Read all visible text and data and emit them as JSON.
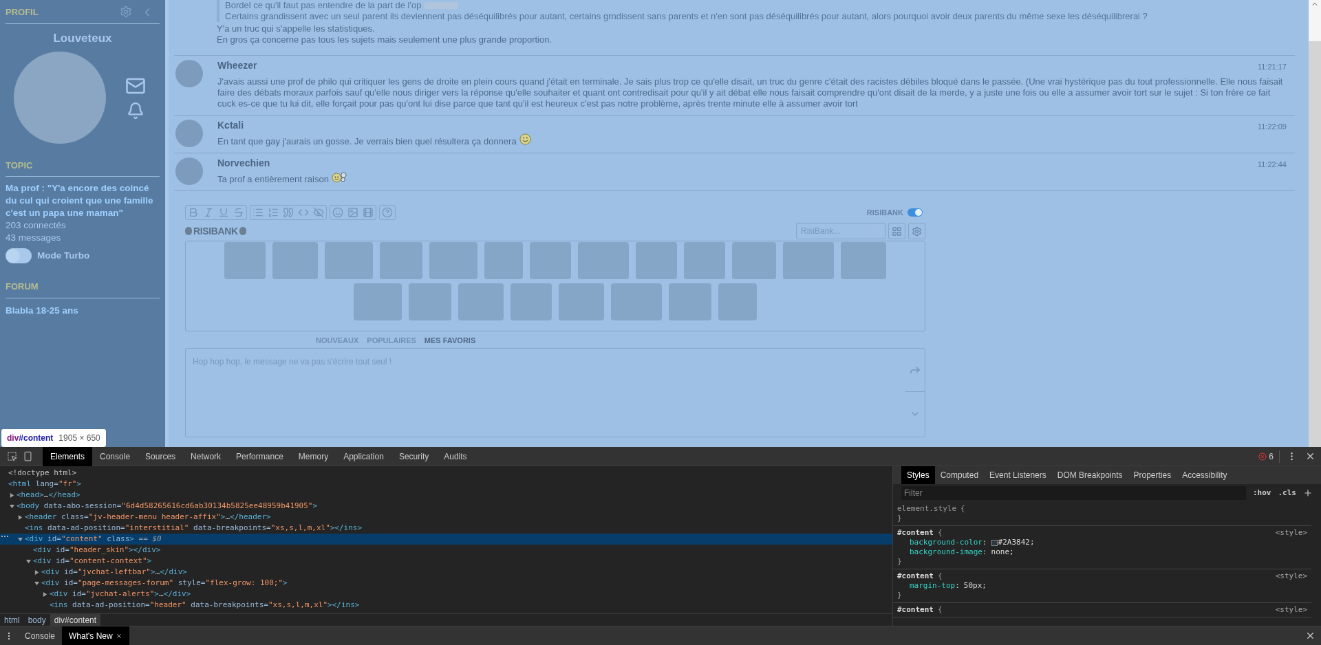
{
  "sidebar": {
    "profile": {
      "heading": "PROFIL",
      "username": "Louveteux"
    },
    "topic": {
      "heading": "TOPIC",
      "title": "Ma prof : \"Y'a encore des coincé du cul qui croient que une famille c'est un papa une maman\"",
      "connected": "203 connectés",
      "messages": "43 messages",
      "turbo": {
        "label": "Mode Turbo",
        "on": false
      }
    },
    "forum": {
      "heading": "FORUM",
      "name": "Blabla 18-25 ans"
    }
  },
  "thread": {
    "continuation": {
      "quote": [
        "Bordel ce qu'il faut pas entendre de la part de l'op",
        "Certains grandissent avec un seul parent ils deviennent pas déséquilibrés pour autant, certains grndissent sans parents et n'en sont pas déséquilibrés pour autant, alors pourquoi avoir deux parents du même sexe les déséquilibrerai ?"
      ],
      "lines": [
        "Y'a un truc qui s'appelle les statistiques.",
        "En gros ça concerne pas tous les sujets mais seulement une plus grande proportion."
      ]
    },
    "messages": [
      {
        "author": "Wheezer",
        "time": "11:21:17",
        "text": "J'avais aussi une prof de philo qui critiquer les gens de droite en plein cours quand j'était en terminale. Je sais plus trop ce qu'elle disait, un truc du genre c'était des racistes débiles bloqué dans le passée. (Une vrai hystérique pas du tout professionnelle. Elle nous faisait faire des débats moraux parfois sauf qu'elle nous diriger vers la réponse qu'elle souhaiter et quant ont contredisait pour qu'il y ait débat elle nous faisait comprendre qu'ont disait de la merde, y a juste une fois ou elle a assumer avoir tort sur le sujet : Si ton frère ce fait cuck es-ce que tu lui dit, elle forçait pour pas qu'ont lui dise parce que tant qu'il est heureux c'est pas notre problème, après trente minute elle à assumer avoir tort"
      },
      {
        "author": "Kctali",
        "time": "11:22:09",
        "text": "En tant que gay j'aurais un gosse. Je verrais bien quel résultera ça donnera",
        "emoticon": {
          "kind": "smile"
        }
      },
      {
        "author": "Norvechien",
        "time": "11:22:44",
        "text": "Ta prof a entièrement raison",
        "emoticon": {
          "kind": "bubble"
        }
      }
    ]
  },
  "editor": {
    "risibank_toggle": {
      "label": "RISIBANK",
      "on": true
    },
    "logo": "RISIBANK",
    "search": {
      "placeholder": "RisiBank..."
    },
    "tabs": [
      {
        "label": "NOUVEAUX",
        "selected": false
      },
      {
        "label": "POPULAIRES",
        "selected": false
      },
      {
        "label": "MES FAVORIS",
        "selected": true
      }
    ],
    "message": {
      "placeholder": "Hop hop hop, le message ne va pas s'écrire tout seul !"
    }
  },
  "inspect_tooltip": {
    "tag": "div",
    "id": "#content",
    "size": "1905 × 650"
  },
  "devtools": {
    "tabs": [
      {
        "label": "Elements",
        "selected": true
      },
      {
        "label": "Console",
        "selected": false
      },
      {
        "label": "Sources",
        "selected": false
      },
      {
        "label": "Network",
        "selected": false
      },
      {
        "label": "Performance",
        "selected": false
      },
      {
        "label": "Memory",
        "selected": false
      },
      {
        "label": "Application",
        "selected": false
      },
      {
        "label": "Security",
        "selected": false
      },
      {
        "label": "Audits",
        "selected": false
      }
    ],
    "error_count": "6",
    "dom": [
      {
        "tokens": [
          {
            "kind": "doctype",
            "t": "<!doctype html>"
          }
        ],
        "selected": false
      },
      {
        "tokens": [
          {
            "kind": "tag",
            "t": "<html"
          },
          {
            "kind": "attr",
            "t": " lang="
          },
          {
            "kind": "value",
            "t": "\"fr\""
          },
          {
            "kind": "tag",
            "t": ">"
          }
        ],
        "selected": false,
        "children": [
          {
            "tokens": [
              {
                "kind": "tag",
                "t": "<head>"
              },
              {
                "kind": "text",
                "t": "…"
              },
              {
                "kind": "tag",
                "t": "</head>"
              }
            ],
            "expanded": false,
            "selected": false
          },
          {
            "tokens": [
              {
                "kind": "tag",
                "t": "<body"
              },
              {
                "kind": "attr",
                "t": " data-abo-session="
              },
              {
                "kind": "value",
                "t": "\"6d4d58265616cd6ab30134b5825ee48959b41905\""
              },
              {
                "kind": "tag",
                "t": ">"
              }
            ],
            "expanded": true,
            "selected": false,
            "children": [
              {
                "tokens": [
                  {
                    "kind": "tag",
                    "t": "<header"
                  },
                  {
                    "kind": "attr",
                    "t": " class="
                  },
                  {
                    "kind": "value",
                    "t": "\"jv-header-menu header-affix\""
                  },
                  {
                    "kind": "tag",
                    "t": ">"
                  },
                  {
                    "kind": "text",
                    "t": "…"
                  },
                  {
                    "kind": "tag",
                    "t": "</header>"
                  }
                ],
                "expanded": false,
                "selected": false
              },
              {
                "tokens": [
                  {
                    "kind": "tag",
                    "t": "<ins"
                  },
                  {
                    "kind": "attr",
                    "t": " data-ad-position="
                  },
                  {
                    "kind": "value",
                    "t": "\"interstitial\""
                  },
                  {
                    "kind": "attr",
                    "t": " data-breakpoints="
                  },
                  {
                    "kind": "value",
                    "t": "\"xs,s,l,m,xl\""
                  },
                  {
                    "kind": "tag",
                    "t": "></ins>"
                  }
                ],
                "selected": false
              },
              {
                "tokens": [
                  {
                    "kind": "tag",
                    "t": "<div"
                  },
                  {
                    "kind": "attr",
                    "t": " id="
                  },
                  {
                    "kind": "value",
                    "t": "\"content\""
                  },
                  {
                    "kind": "attr",
                    "t": " class"
                  },
                  {
                    "kind": "tag",
                    "t": ">"
                  },
                  {
                    "kind": "hint",
                    "t": " == $0"
                  }
                ],
                "expanded": true,
                "selected": true,
                "children": [
                  {
                    "tokens": [
                      {
                        "kind": "tag",
                        "t": "<div"
                      },
                      {
                        "kind": "attr",
                        "t": " id="
                      },
                      {
                        "kind": "value",
                        "t": "\"header_skin\""
                      },
                      {
                        "kind": "tag",
                        "t": "></div>"
                      }
                    ],
                    "selected": false
                  },
                  {
                    "tokens": [
                      {
                        "kind": "tag",
                        "t": "<div"
                      },
                      {
                        "kind": "attr",
                        "t": " id="
                      },
                      {
                        "kind": "value",
                        "t": "\"content-context\""
                      },
                      {
                        "kind": "tag",
                        "t": ">"
                      }
                    ],
                    "expanded": true,
                    "selected": false,
                    "children": [
                      {
                        "tokens": [
                          {
                            "kind": "tag",
                            "t": "<div"
                          },
                          {
                            "kind": "attr",
                            "t": " id="
                          },
                          {
                            "kind": "value",
                            "t": "\"jvchat-leftbar\""
                          },
                          {
                            "kind": "tag",
                            "t": ">"
                          },
                          {
                            "kind": "text",
                            "t": "…"
                          },
                          {
                            "kind": "tag",
                            "t": "</div>"
                          }
                        ],
                        "expanded": false,
                        "selected": false
                      },
                      {
                        "tokens": [
                          {
                            "kind": "tag",
                            "t": "<div"
                          },
                          {
                            "kind": "attr",
                            "t": " id="
                          },
                          {
                            "kind": "value",
                            "t": "\"page-messages-forum\""
                          },
                          {
                            "kind": "attr",
                            "t": " style="
                          },
                          {
                            "kind": "value",
                            "t": "\"flex-grow: 100;\""
                          },
                          {
                            "kind": "tag",
                            "t": ">"
                          }
                        ],
                        "expanded": true,
                        "selected": false,
                        "children": [
                          {
                            "tokens": [
                              {
                                "kind": "tag",
                                "t": "<div"
                              },
                              {
                                "kind": "attr",
                                "t": " id="
                              },
                              {
                                "kind": "value",
                                "t": "\"jvchat-alerts\""
                              },
                              {
                                "kind": "tag",
                                "t": ">"
                              },
                              {
                                "kind": "text",
                                "t": "…"
                              },
                              {
                                "kind": "tag",
                                "t": "</div>"
                              }
                            ],
                            "expanded": false,
                            "selected": false
                          },
                          {
                            "tokens": [
                              {
                                "kind": "tag",
                                "t": "<ins"
                              },
                              {
                                "kind": "attr",
                                "t": " data-ad-position="
                              },
                              {
                                "kind": "value",
                                "t": "\"header\""
                              },
                              {
                                "kind": "attr",
                                "t": " data-breakpoints="
                              },
                              {
                                "kind": "value",
                                "t": "\"xs,s,l,m,xl\""
                              },
                              {
                                "kind": "tag",
                                "t": "></ins>"
                              }
                            ],
                            "selected": false
                          }
                        ]
                      }
                    ]
                  }
                ]
              }
            ]
          }
        ]
      }
    ],
    "breadcrumbs": [
      {
        "label": "html",
        "selected": false
      },
      {
        "label": "body",
        "selected": false
      },
      {
        "label": "div#content",
        "selected": true
      }
    ],
    "styles": {
      "tabs": [
        {
          "label": "Styles",
          "selected": true
        },
        {
          "label": "Computed",
          "selected": false
        },
        {
          "label": "Event Listeners",
          "selected": false
        },
        {
          "label": "DOM Breakpoints",
          "selected": false
        },
        {
          "label": "Properties",
          "selected": false
        },
        {
          "label": "Accessibility",
          "selected": false
        }
      ],
      "filter": {
        "placeholder": "Filter"
      },
      "hov": ":hov",
      "cls": ".cls",
      "rules": [
        {
          "selector": "element.style",
          "open": "{",
          "close": "}",
          "inline": true
        },
        {
          "selector": "#content",
          "open": "{",
          "close": "}",
          "source": "<style>",
          "inline": false,
          "props": [
            {
              "name": "background-color",
              "sep": ":",
              "value": "#2A3842;",
              "color": "#2a3842"
            },
            {
              "name": "background-image",
              "sep": ":",
              "value": "none;"
            }
          ]
        },
        {
          "selector": "#content",
          "open": "{",
          "close": "}",
          "source": "<style>",
          "inline": false,
          "props": [
            {
              "name": "margin-top",
              "sep": ":",
              "value": "50px;"
            }
          ]
        },
        {
          "selector": "#content",
          "open": "{",
          "source": "<style>",
          "inline": false
        }
      ]
    },
    "drawer": {
      "tabs": [
        {
          "label": "Console",
          "selected": false
        },
        {
          "label": "What's New",
          "selected": true
        }
      ]
    }
  }
}
